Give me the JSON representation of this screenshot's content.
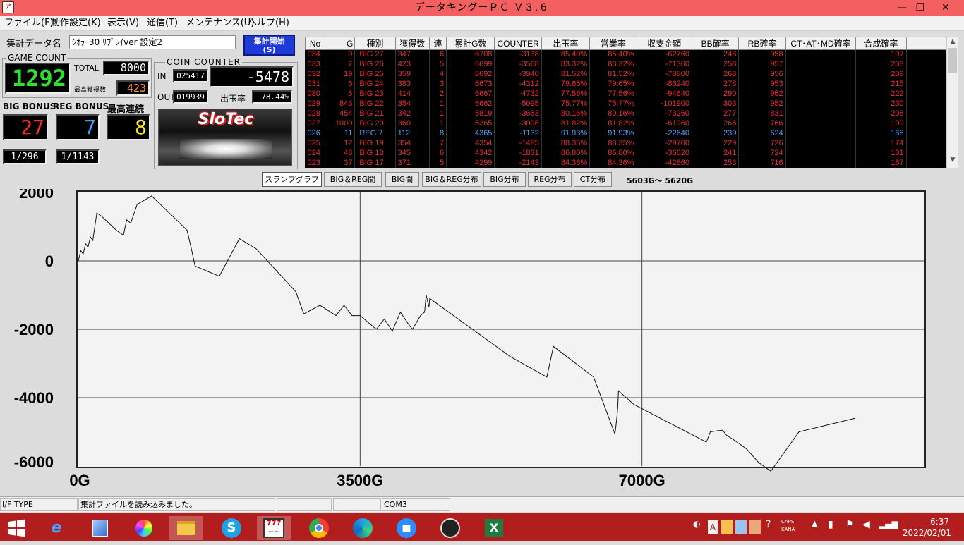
{
  "window": {
    "title": "データキングーＰＣ Ｖ３.６",
    "minimize": "—",
    "maximize": "❐",
    "close": "✕"
  },
  "menu": [
    "ファイル(F)",
    "動作設定(K)",
    "表示(V)",
    "通信(T)",
    "メンテナンス(U)",
    "ヘルプ(H)"
  ],
  "panel": {
    "data_label": "集計データ名",
    "data_value": "ｼｵﾗｰ30 ﾘﾌﾟﾚｲver 設定2",
    "start_button": "集計開始\n(S)",
    "game_count_title": "GAME COUNT",
    "game_count": "1292",
    "total_label": "TOTAL",
    "total_value": "8000",
    "max_label": "最高獲得数",
    "max_value": "423",
    "coin_counter_title": "COIN COUNTER",
    "in_label": "IN",
    "in_value": "025417",
    "coin_diff": "-5478",
    "out_label": "OUT",
    "out_value": "019939",
    "payout_label": "出玉率",
    "payout_value": "78.44%",
    "big_label": "BIG BONUS",
    "big_value": "27",
    "reg_label": "REG BONUS",
    "reg_value": "7",
    "streak_label": "最高連続",
    "streak_value": "8",
    "big_ratio": "1/296",
    "reg_ratio": "1/1143",
    "logo": "SloTec"
  },
  "table": {
    "columns": [
      "No",
      "G",
      "種別",
      "獲得数",
      "連",
      "累計G数",
      "COUNTER",
      "出玉率",
      "営業率",
      "収支金額",
      "BB確率",
      "RB確率",
      "CT･AT･MD確率",
      "合成確率"
    ],
    "rows": [
      [
        "034",
        "9",
        "BIG 27",
        "347",
        "6",
        "6708",
        "-3138",
        "85.40%",
        "85.40%",
        "-62760",
        "248",
        "958",
        "",
        "197"
      ],
      [
        "033",
        "7",
        "BIG 26",
        "423",
        "5",
        "6699",
        "-3568",
        "83.32%",
        "83.32%",
        "-71360",
        "258",
        "957",
        "",
        "203"
      ],
      [
        "032",
        "19",
        "BIG 25",
        "359",
        "4",
        "6692",
        "-3940",
        "81.52%",
        "81.52%",
        "-78800",
        "268",
        "956",
        "",
        "209"
      ],
      [
        "031",
        "6",
        "BIG 24",
        "383",
        "3",
        "6673",
        "-4312",
        "79.65%",
        "79.65%",
        "-86240",
        "278",
        "953",
        "",
        "215"
      ],
      [
        "030",
        "5",
        "BIG 23",
        "414",
        "2",
        "6667",
        "-4732",
        "77.56%",
        "77.56%",
        "-94640",
        "290",
        "952",
        "",
        "222"
      ],
      [
        "029",
        "843",
        "BIG 22",
        "354",
        "1",
        "6662",
        "-5095",
        "75.77%",
        "75.77%",
        "-101900",
        "303",
        "952",
        "",
        "230"
      ],
      [
        "028",
        "454",
        "BIG 21",
        "342",
        "1",
        "5819",
        "-3663",
        "80.16%",
        "80.16%",
        "-73260",
        "277",
        "831",
        "",
        "208"
      ],
      [
        "027",
        "1000",
        "BIG 20",
        "360",
        "1",
        "5365",
        "-3098",
        "81.82%",
        "81.82%",
        "-61960",
        "268",
        "766",
        "",
        "199"
      ],
      [
        "026",
        "11",
        "REG 7",
        "112",
        "8",
        "4365",
        "-1132",
        "91.93%",
        "91.93%",
        "-22640",
        "230",
        "624",
        "",
        "168"
      ],
      [
        "025",
        "12",
        "BIG 19",
        "354",
        "7",
        "4354",
        "-1485",
        "88.35%",
        "88.35%",
        "-29700",
        "229",
        "726",
        "",
        "174"
      ],
      [
        "024",
        "48",
        "BIG 18",
        "345",
        "6",
        "4342",
        "-1831",
        "86.80%",
        "86.80%",
        "-36620",
        "241",
        "724",
        "",
        "181"
      ],
      [
        "023",
        "37",
        "BIG 17",
        "371",
        "5",
        "4299",
        "-2143",
        "84.36%",
        "84.36%",
        "-42860",
        "253",
        "716",
        "",
        "187"
      ]
    ]
  },
  "tabs": [
    "スランプグラフ",
    "BIG＆REG間",
    "BIG間",
    "BIG＆REG分布",
    "BIG分布",
    "REG分布",
    "CT分布"
  ],
  "tab_range": "5603G～ 5620G",
  "chart_data": {
    "type": "line",
    "title": "",
    "xlabel": "",
    "ylabel": "",
    "xlim": [
      0,
      10500
    ],
    "ylim": [
      -6000,
      2000
    ],
    "y_ticks": [
      2000,
      0,
      -2000,
      -4000,
      -6000
    ],
    "y_tick_labels": [
      "2000",
      "0",
      "-2000",
      "-4000",
      "-6000"
    ],
    "x_ticks": [
      0,
      3500,
      7000
    ],
    "x_tick_labels": [
      "0G",
      "3500G",
      "7000G"
    ],
    "grid": true,
    "series": [
      {
        "x": [
          0,
          30,
          60,
          90,
          120,
          150,
          180,
          230,
          290,
          470,
          560,
          600,
          650,
          730,
          910,
          1350,
          1400,
          1450,
          1750,
          2000,
          2210,
          2700,
          2800,
          3000,
          3200,
          3300,
          3400,
          3500,
          3700,
          3800,
          3900,
          4000,
          4100,
          4150,
          4250,
          4300,
          4320,
          4354,
          4365,
          5365,
          5819,
          5900,
          6400,
          6662,
          6667,
          6673,
          6692,
          6699,
          6708,
          6900,
          7800,
          7850,
          8000,
          8050,
          8150,
          8300,
          8450,
          8600,
          8950,
          9650
        ],
        "y": [
          0,
          300,
          200,
          500,
          400,
          700,
          600,
          1400,
          1300,
          900,
          750,
          1200,
          1100,
          1650,
          1900,
          900,
          400,
          -150,
          -450,
          650,
          350,
          -900,
          -1550,
          -1300,
          -1600,
          -1300,
          -1600,
          -1600,
          -2000,
          -1700,
          -2050,
          -1500,
          -1850,
          -2000,
          -1600,
          -1500,
          -1000,
          -1350,
          -1100,
          -2800,
          -3400,
          -2500,
          -3400,
          -5050,
          -5000,
          -4900,
          -4500,
          -4300,
          -3800,
          -4200,
          -5300,
          -5000,
          -4950,
          -5100,
          -5250,
          -5500,
          -5900,
          -6150,
          -5000,
          -4600
        ]
      }
    ]
  },
  "status": {
    "cell0": "I/F TYPE",
    "cell1": "集計ファイルを読み込みました。",
    "cell2": "",
    "cell3": "",
    "cell4": "COM3"
  },
  "taskbar": {
    "icons": [
      "windows-icon",
      "ie-icon",
      "notepad-icon",
      "paint-icon",
      "explorer-icon",
      "skype-icon",
      "dataking-icon",
      "chrome-icon",
      "edge-icon",
      "zoom-icon",
      "obs-icon",
      "excel-icon"
    ],
    "caps": "CAPS",
    "kana": "KANA",
    "time": "6:37",
    "date": "2022/02/01"
  }
}
